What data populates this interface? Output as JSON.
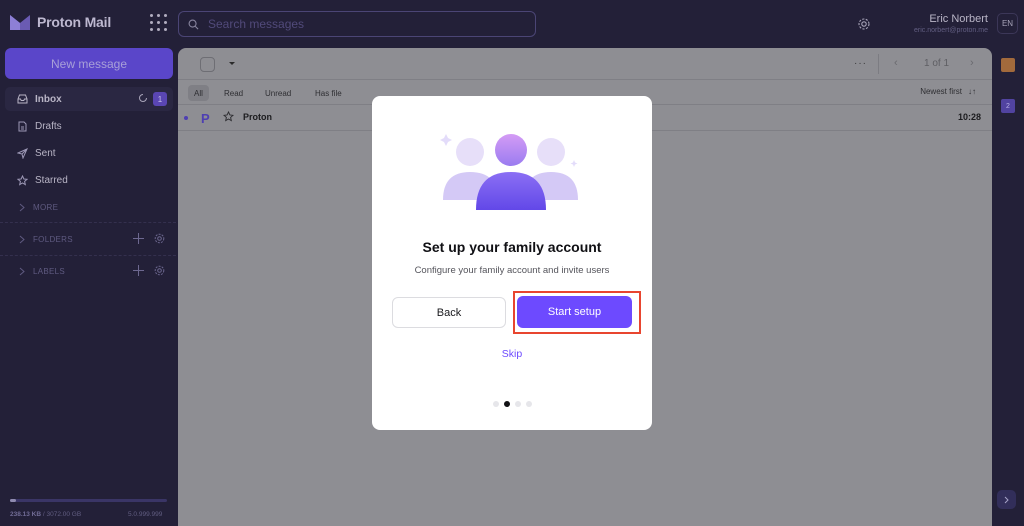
{
  "app": {
    "name": "Proton Mail"
  },
  "search": {
    "placeholder": "Search messages"
  },
  "user": {
    "name": "Eric Norbert",
    "email": "eric.norbert@proton.me",
    "language": "EN"
  },
  "sidebar": {
    "new_message_label": "New message",
    "items": [
      {
        "label": "Inbox",
        "icon": "inbox-icon",
        "count": "1",
        "active": true
      },
      {
        "label": "Drafts",
        "icon": "drafts-icon"
      },
      {
        "label": "Sent",
        "icon": "sent-icon"
      },
      {
        "label": "Starred",
        "icon": "star-icon"
      }
    ],
    "more_label": "MORE",
    "folders_label": "FOLDERS",
    "labels_label": "LABELS",
    "storage": {
      "used": "238.13 KB",
      "separator": " / ",
      "total": "3072.00 GB",
      "used_fraction": 0.01
    },
    "version": "5.0.999.999"
  },
  "toolbar": {
    "more_label": "···",
    "pager": "1 of 1"
  },
  "filters": {
    "chips": [
      "All",
      "Read",
      "Unread",
      "Has file"
    ],
    "active": "All",
    "sort_label": "Newest first"
  },
  "messages": [
    {
      "sender": "Proton",
      "time": "10:28",
      "unread": true
    }
  ],
  "rail": {
    "badge_count": "2"
  },
  "modal": {
    "title": "Set up your family account",
    "subtitle": "Configure your family account and invite users",
    "back_label": "Back",
    "start_label": "Start setup",
    "skip_label": "Skip",
    "steps_total": 4,
    "step_active": 2,
    "colors": {
      "primary": "#6d4aff",
      "highlight": "#e8452f"
    }
  }
}
